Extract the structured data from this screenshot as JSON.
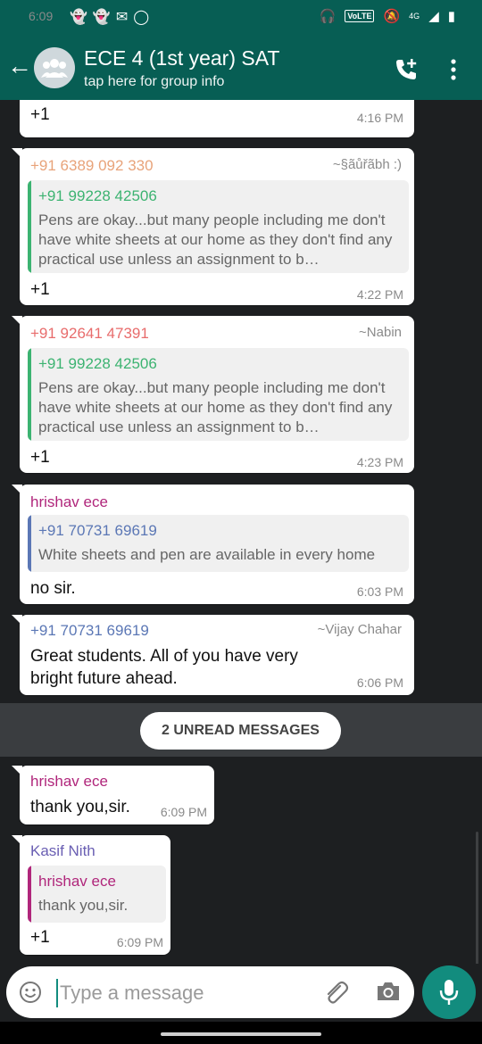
{
  "status_bar": {
    "time": "6:09",
    "network": "4G",
    "volte": "VoLTE"
  },
  "header": {
    "title": "ECE 4 (1st year) SAT",
    "subtitle": "tap here for group info"
  },
  "messages": [
    {
      "text": "+1",
      "time": "4:16 PM"
    },
    {
      "sender": "+91 6389 092 330",
      "sender_color": "#e8a37a",
      "alias": "~§ãůřãbh :)",
      "quote": {
        "name": "+91 99228 42506",
        "name_color": "#3cb371",
        "bar_color": "#3cb371",
        "text": "Pens are okay...but many people including me don't have white sheets at our home as they don't find any practical use unless an assignment to b…"
      },
      "text": "+1",
      "time": "4:22 PM"
    },
    {
      "sender": "+91 92641 47391",
      "sender_color": "#e86c6c",
      "alias": "~Nabin",
      "quote": {
        "name": "+91 99228 42506",
        "name_color": "#3cb371",
        "bar_color": "#3cb371",
        "text": "Pens are okay...but many people including me don't have white sheets at our home as they don't find any practical use unless an assignment to b…"
      },
      "text": "+1",
      "time": "4:23 PM"
    },
    {
      "sender": "hrishav ece",
      "sender_color": "#b0267b",
      "quote": {
        "name": "+91 70731 69619",
        "name_color": "#5b77b5",
        "bar_color": "#5b77b5",
        "text": "White sheets and pen are available in every home"
      },
      "text": "no sir.",
      "time": "6:03 PM"
    },
    {
      "sender": "+91 70731 69619",
      "sender_color": "#5b77b5",
      "alias": "~Vijay Chahar",
      "text": "Great students. All of you have very bright future ahead.",
      "time": "6:06 PM"
    },
    {
      "sender": "hrishav ece",
      "sender_color": "#b0267b",
      "text": "thank you,sir.",
      "time": "6:09 PM"
    },
    {
      "sender": "Kasif Nith",
      "sender_color": "#6a5fb3",
      "quote": {
        "name": "hrishav ece",
        "name_color": "#b0267b",
        "bar_color": "#b0267b",
        "text": "thank you,sir."
      },
      "text": "+1",
      "time": "6:09 PM"
    }
  ],
  "unread_label": "2 UNREAD MESSAGES",
  "composer": {
    "placeholder": "Type a message"
  },
  "colors": {
    "header_bg": "#075e54",
    "accent": "#128c7e",
    "chat_bg": "#1d1f21"
  }
}
